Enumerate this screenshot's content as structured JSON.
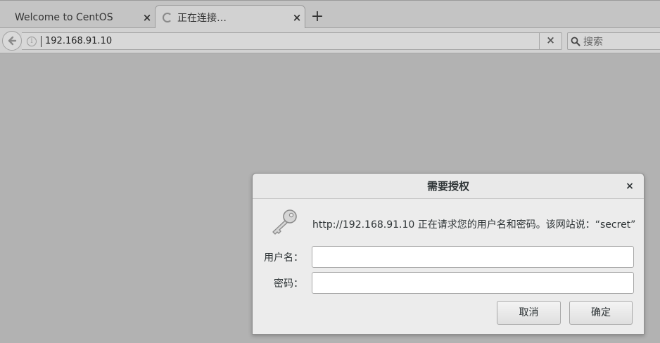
{
  "tabs": [
    {
      "title": "Welcome to CentOS",
      "active": false
    },
    {
      "title": "正在连接…",
      "active": true,
      "loading": true
    }
  ],
  "tabstrip": {
    "close_icon": "×",
    "new_tab_icon": "+"
  },
  "navbar": {
    "back_icon": "back-arrow-icon",
    "url": "192.168.91.10",
    "clear_icon": "×",
    "search_placeholder": "搜索"
  },
  "dialog": {
    "title": "需要授权",
    "close_icon": "×",
    "message": "http://192.168.91.10 正在请求您的用户名和密码。该网站说：“secret”",
    "username_label": "用户名：",
    "password_label": "密码：",
    "username_value": "",
    "password_value": "",
    "cancel_label": "取消",
    "ok_label": "确定"
  },
  "colors": {
    "page_background": "#b2b2b2",
    "chrome_background": "#d2d2d2",
    "dialog_background": "#ececec"
  }
}
